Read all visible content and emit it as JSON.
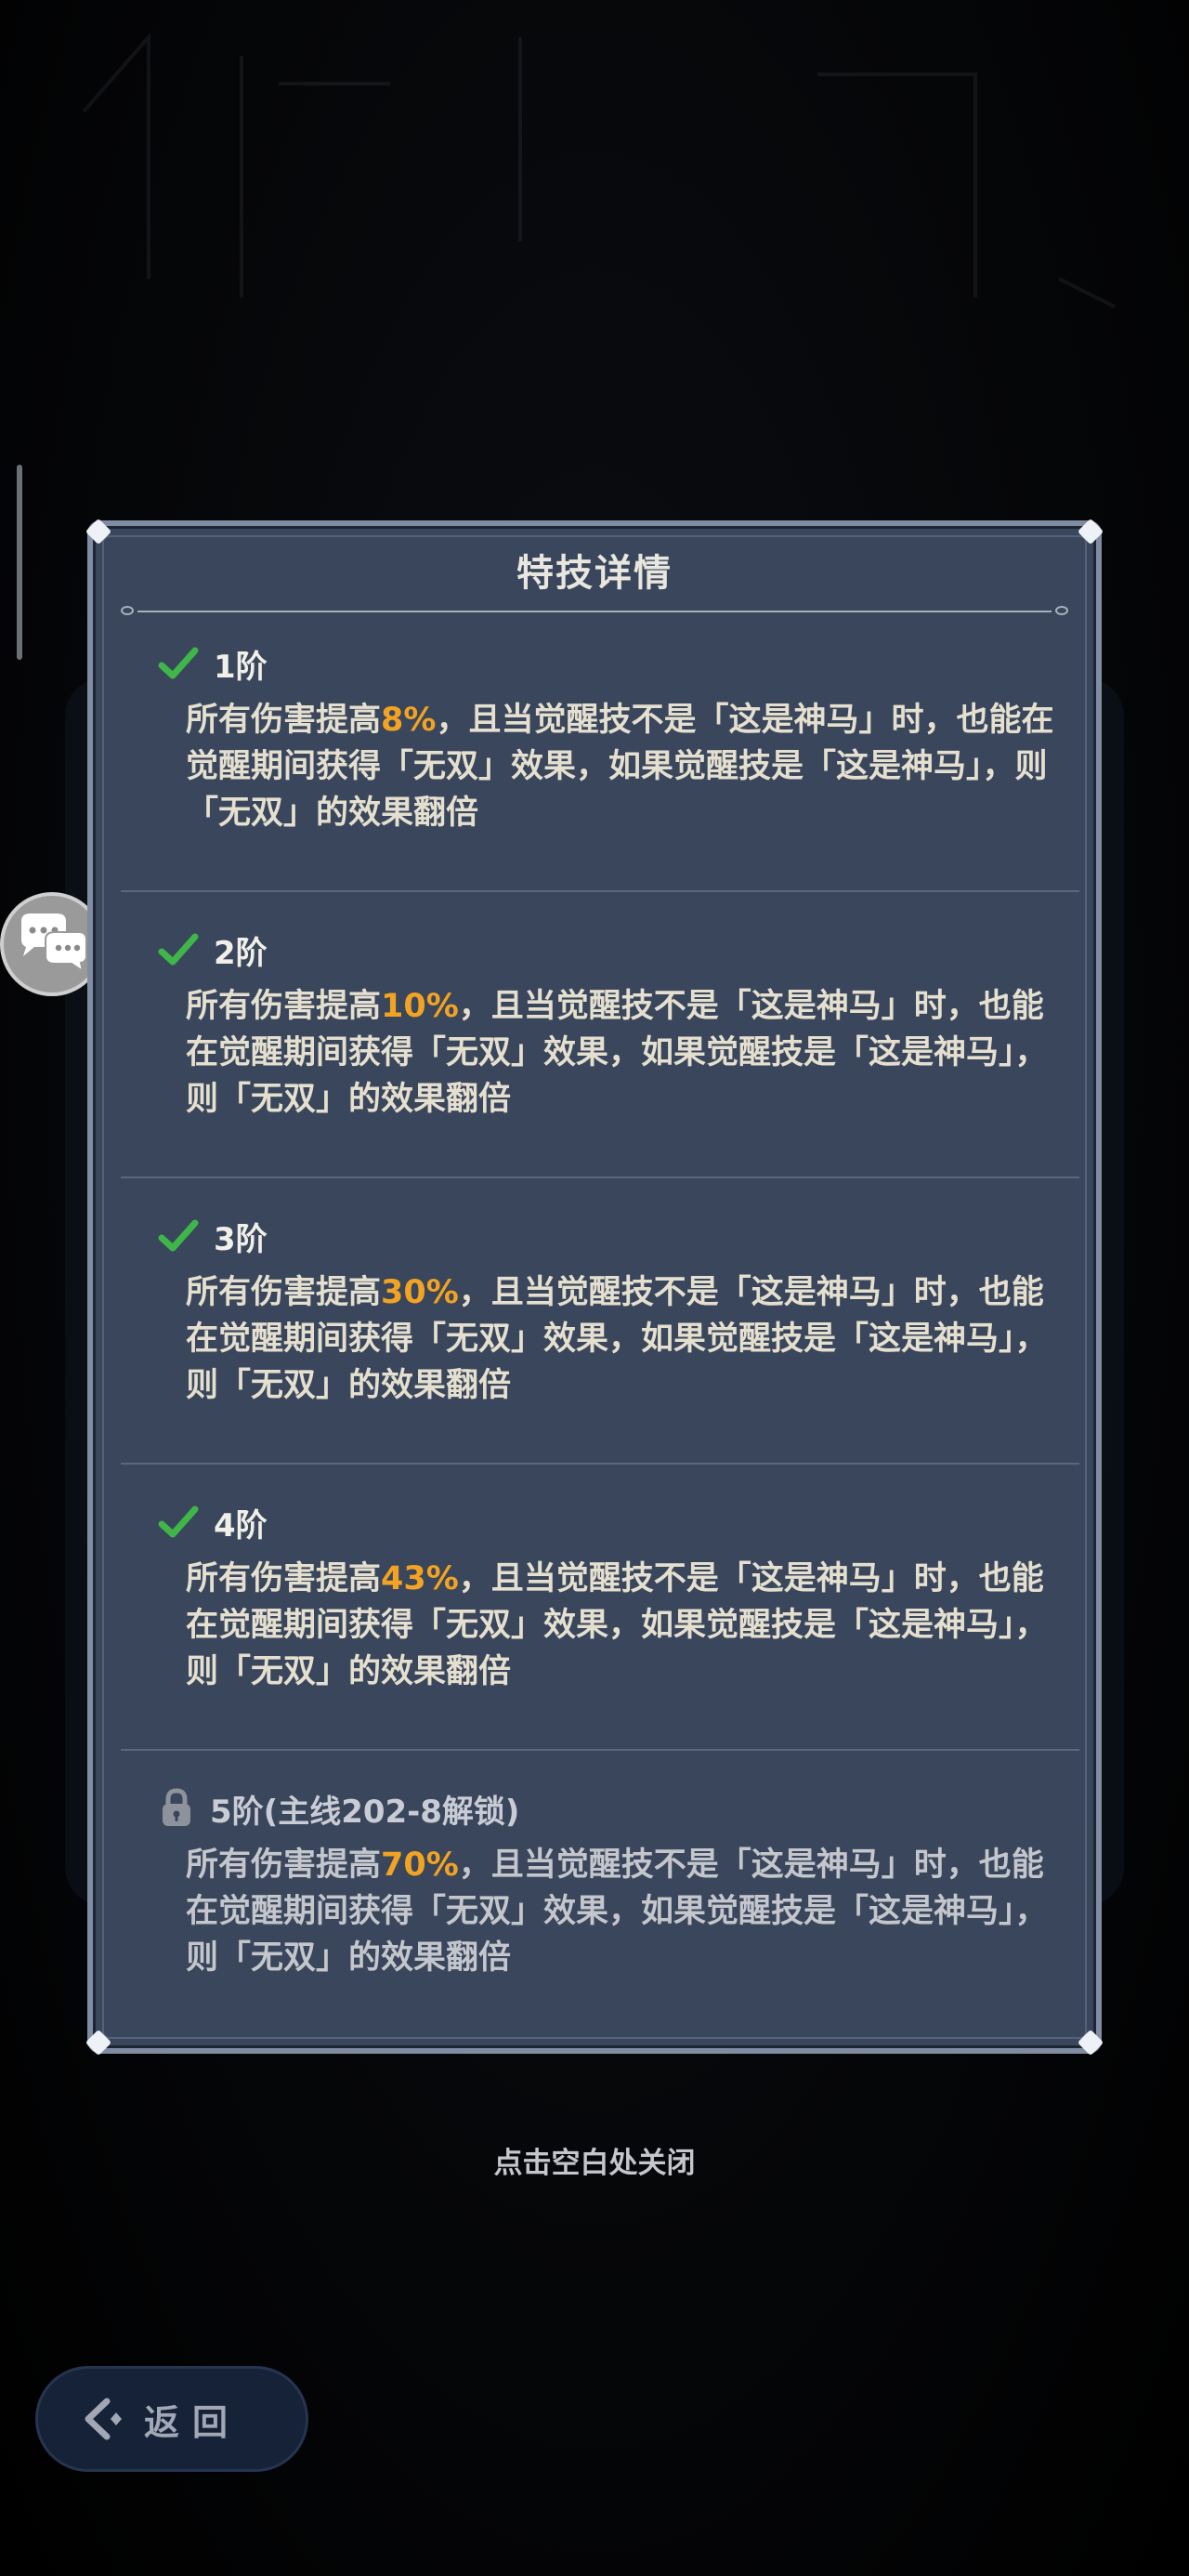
{
  "dialog": {
    "title": "特技详情",
    "tiers": [
      {
        "label": "1阶",
        "status": "unlocked",
        "desc_prefix": "所有伤害提高",
        "value": "8%",
        "desc_suffix": "，且当觉醒技不是「这是神马」时，也能在觉醒期间获得「无双」效果，如果觉醒技是「这是神马」，则「无双」的效果翻倍"
      },
      {
        "label": "2阶",
        "status": "unlocked",
        "desc_prefix": "所有伤害提高",
        "value": "10%",
        "desc_suffix": "，且当觉醒技不是「这是神马」时，也能在觉醒期间获得「无双」效果，如果觉醒技是「这是神马」，则「无双」的效果翻倍"
      },
      {
        "label": "3阶",
        "status": "unlocked",
        "desc_prefix": "所有伤害提高",
        "value": "30%",
        "desc_suffix": "，且当觉醒技不是「这是神马」时，也能在觉醒期间获得「无双」效果，如果觉醒技是「这是神马」，则「无双」的效果翻倍"
      },
      {
        "label": "4阶",
        "status": "unlocked",
        "desc_prefix": "所有伤害提高",
        "value": "43%",
        "desc_suffix": "，且当觉醒技不是「这是神马」时，也能在觉醒期间获得「无双」效果，如果觉醒技是「这是神马」，则「无双」的效果翻倍"
      },
      {
        "label": "5阶(主线202-8解锁)",
        "status": "locked",
        "desc_prefix": "所有伤害提高",
        "value": "70%",
        "desc_suffix": "，且当觉醒技不是「这是神马」时，也能在觉醒期间获得「无双」效果，如果觉醒技是「这是神马」，则「无双」的效果翻倍"
      }
    ]
  },
  "close_hint": "点击空白处关闭",
  "back_button": {
    "label": "返回"
  },
  "icons": {
    "unlocked": "check-icon",
    "locked": "lock-icon",
    "chat": "chat-bubbles-icon",
    "back": "back-arrow-icon"
  },
  "colors": {
    "panel_bg": "#39465b",
    "panel_border": "#7f8ca2",
    "highlight": "#f2a323",
    "check": "#3fb54a",
    "text": "#e5dfcf"
  }
}
